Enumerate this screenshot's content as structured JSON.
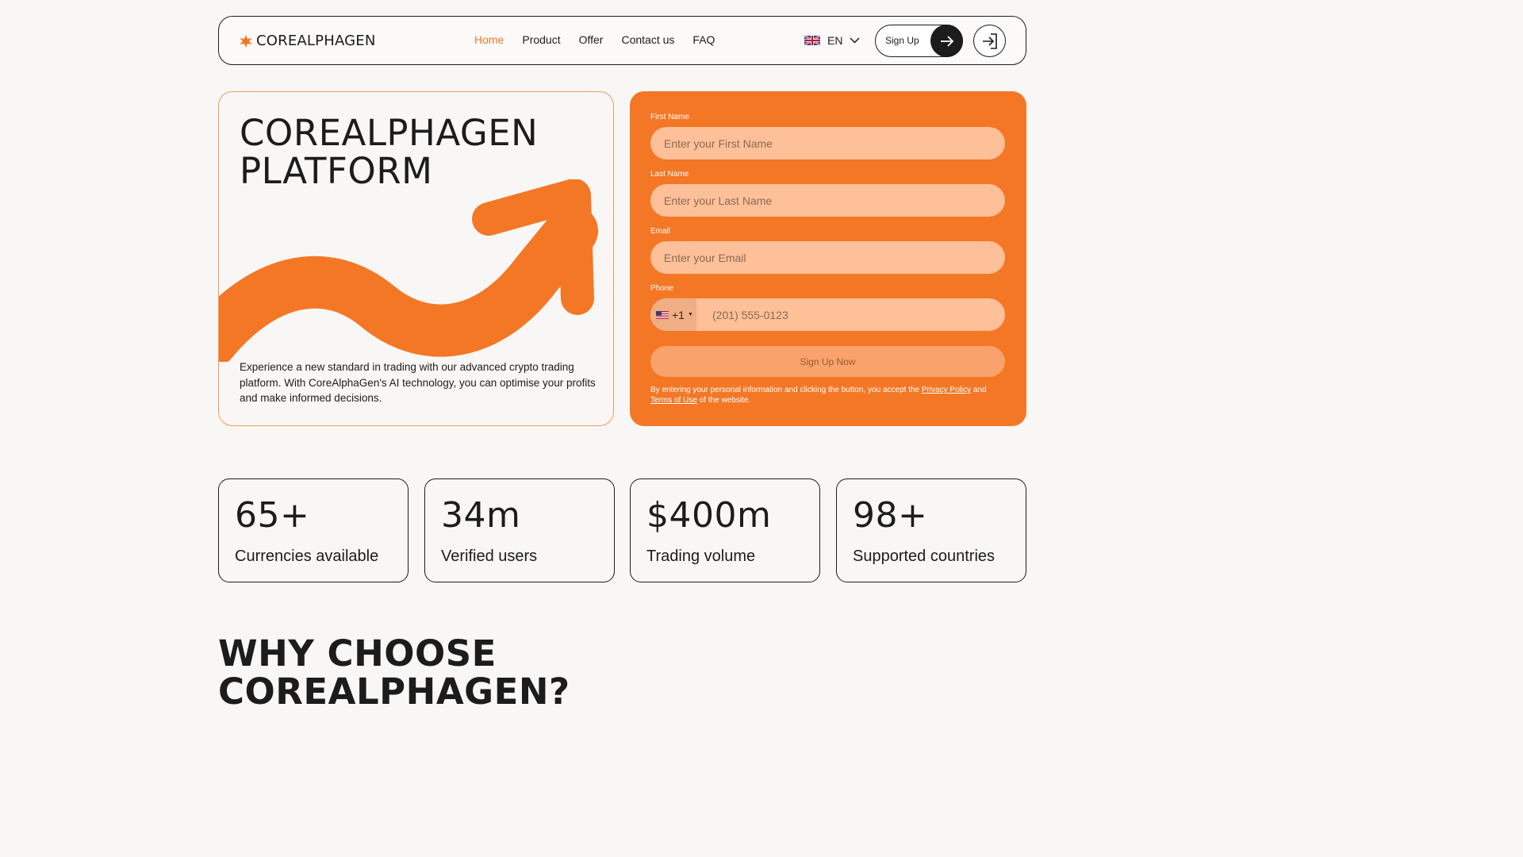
{
  "header": {
    "logo_text": "COREALPHAGEN",
    "nav": [
      "Home",
      "Product",
      "Offer",
      "Contact us",
      "FAQ"
    ],
    "active_nav": "Home",
    "language": "EN",
    "signup_label": "Sign Up"
  },
  "hero": {
    "title_line1": "COREALPHAGEN",
    "title_line2": "PLATFORM",
    "description": "Experience a new standard in trading with our advanced crypto trading platform. With CoreAlphaGen's AI technology, you can optimise your profits and make informed decisions."
  },
  "form": {
    "first_name_label": "First Name",
    "first_name_placeholder": "Enter your First Name",
    "last_name_label": "Last Name",
    "last_name_placeholder": "Enter your Last Name",
    "email_label": "Email",
    "email_placeholder": "Enter your Email",
    "phone_label": "Phone",
    "phone_code": "+1",
    "phone_placeholder": "(201) 555-0123",
    "submit_label": "Sign Up Now",
    "legal_prefix": "By entering your personal information and clicking the button, you accept the",
    "privacy_link": "Privacy Policy",
    "legal_and": "and",
    "terms_link": "Terms of Use",
    "legal_suffix": "of the website."
  },
  "stats": [
    {
      "value": "65+",
      "label": "Currencies available"
    },
    {
      "value": "34m",
      "label": "Verified users"
    },
    {
      "value": "$400m",
      "label": "Trading volume"
    },
    {
      "value": "98+",
      "label": "Supported countries"
    }
  ],
  "why": {
    "title_line1": "WHY CHOOSE",
    "title_line2": "COREALPHAGEN?"
  },
  "colors": {
    "accent": "#f47726",
    "input_bg": "#fdc098",
    "text": "#1c1c1c",
    "background": "#f9f7f5"
  },
  "icons": [
    "logo-star-icon",
    "uk-flag-icon",
    "chevron-down-icon",
    "arrow-right-icon",
    "login-icon",
    "us-flag-icon"
  ]
}
